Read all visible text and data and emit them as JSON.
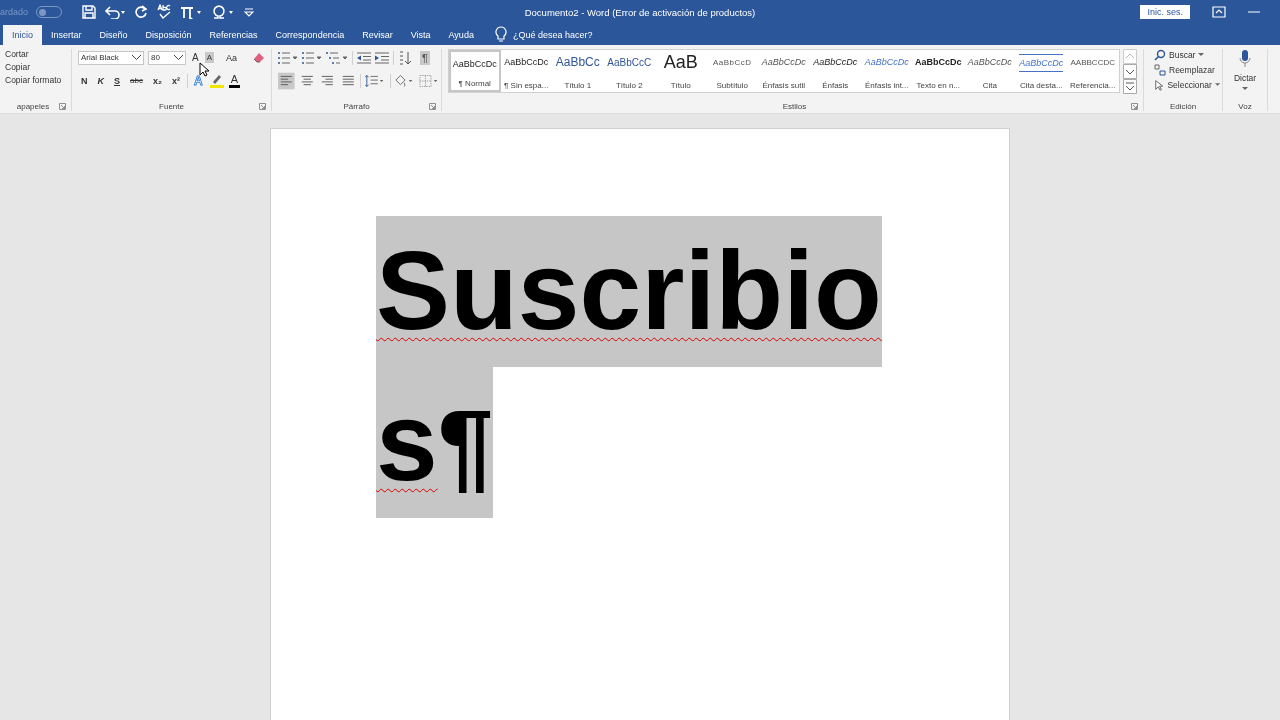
{
  "quick_access": {
    "autosave_label": "ardado",
    "autosave_on": false
  },
  "title": "Documento2  -  Word (Error de activación de productos)",
  "signin": "Inic. ses.",
  "tabs": [
    {
      "label": "Inicio",
      "selected": true
    },
    {
      "label": "Insertar",
      "selected": false
    },
    {
      "label": "Diseño",
      "selected": false
    },
    {
      "label": "Disposición",
      "selected": false
    },
    {
      "label": "Referencias",
      "selected": false
    },
    {
      "label": "Correspondencia",
      "selected": false
    },
    {
      "label": "Revisar",
      "selected": false
    },
    {
      "label": "Vista",
      "selected": false
    },
    {
      "label": "Ayuda",
      "selected": false
    }
  ],
  "tell_me": "¿Qué desea hacer?",
  "clipboard": {
    "items": [
      "Cortar",
      "Copiar",
      "Copiar formato"
    ],
    "label": "apapeles"
  },
  "font": {
    "name": "Arial Black",
    "size": "80",
    "size_buttons": [
      {
        "label": "A",
        "kind": "grow",
        "hovered": false
      },
      {
        "label": "A",
        "kind": "shrink",
        "hovered": true
      }
    ],
    "case_button": "Aa",
    "format_buttons": [
      {
        "label": "N",
        "kind": "bold"
      },
      {
        "label": "K",
        "kind": "italic"
      },
      {
        "label": "S",
        "kind": "underline"
      },
      {
        "label": "abc",
        "kind": "strike"
      },
      {
        "label": "x₂",
        "kind": "sub"
      },
      {
        "label": "x²",
        "kind": "sup"
      }
    ],
    "effects_label": "A",
    "color_label": "A",
    "label": "Fuente"
  },
  "paragraph": {
    "show_marks": {
      "label": "¶",
      "on": true
    },
    "alignments": [
      {
        "kind": "left",
        "selected": true
      },
      {
        "kind": "center",
        "selected": false
      },
      {
        "kind": "right",
        "selected": false
      },
      {
        "kind": "justify",
        "selected": false
      }
    ],
    "label": "Párrafo"
  },
  "styles": {
    "items": [
      {
        "preview": "AaBbCcDc",
        "name": "¶ Normal",
        "kind": "plain",
        "selected": true
      },
      {
        "preview": "AaBbCcDc",
        "name": "¶ Sin espa...",
        "kind": "plain",
        "selected": false
      },
      {
        "preview": "AaBbCc",
        "name": "Título 1",
        "kind": "heading",
        "selected": false
      },
      {
        "preview": "AaBbCcC",
        "name": "Título 2",
        "kind": "heading2",
        "selected": false
      },
      {
        "preview": "AaB",
        "name": "Título",
        "kind": "big",
        "selected": false
      },
      {
        "preview": "AaBbCcD",
        "name": "Subtítulo",
        "kind": "spaced",
        "selected": false
      },
      {
        "preview": "AaBbCcDc",
        "name": "Énfasis sutil",
        "kind": "italic",
        "selected": false
      },
      {
        "preview": "AaBbCcDc",
        "name": "Énfasis",
        "kind": "italic-dark",
        "selected": false
      },
      {
        "preview": "AaBbCcDc",
        "name": "Énfasis int...",
        "kind": "italic-blue",
        "selected": false
      },
      {
        "preview": "AaBbCcDc",
        "name": "Texto en n...",
        "kind": "bold",
        "selected": false
      },
      {
        "preview": "AaBbCcDc",
        "name": "Cita",
        "kind": "italic",
        "selected": false
      },
      {
        "preview": "AaBbCcDc",
        "name": "Cita desta...",
        "kind": "quote-blue",
        "selected": false
      },
      {
        "preview": "AABBCCDC",
        "name": "Referencia...",
        "kind": "caps",
        "selected": false
      }
    ],
    "label": "Estilos"
  },
  "editing": {
    "items": [
      {
        "label": "Buscar",
        "kind": "search",
        "dropdown": true
      },
      {
        "label": "Reemplazar",
        "kind": "replace",
        "dropdown": false
      },
      {
        "label": "Seleccionar",
        "kind": "select",
        "dropdown": true
      }
    ],
    "label": "Edición"
  },
  "voice": {
    "button": "Dictar",
    "label": "Voz"
  },
  "document": {
    "selected": true,
    "lines": [
      {
        "text": "Suscribio",
        "spelling_error": true
      },
      {
        "text": "s",
        "spelling_error": true,
        "mark": "¶"
      }
    ]
  }
}
